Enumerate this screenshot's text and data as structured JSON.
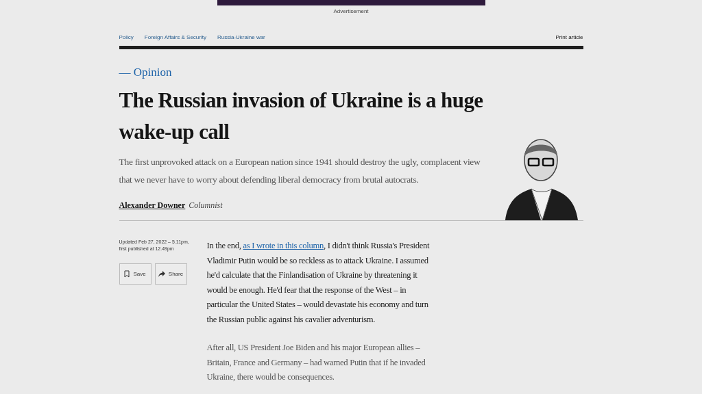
{
  "advertisement": {
    "label": "Advertisement"
  },
  "breadcrumbs": [
    "Policy",
    "Foreign Affairs & Security",
    "Russia-Ukraine war"
  ],
  "print_link": "Print article",
  "section": "— Opinion",
  "headline": "The Russian invasion of Ukraine is a huge wake-up call",
  "standfirst": "The first unprovoked attack on a European nation since 1941 should destroy the ugly, complacent view that we never have to worry about defending liberal democracy from brutal autocrats.",
  "byline": {
    "author": "Alexander Downer",
    "role": "Columnist"
  },
  "meta": {
    "updated": "Updated Feb 27, 2022 – 5.11pm,",
    "published": "first published at 12.49pm"
  },
  "actions": [
    {
      "kind": "save",
      "label": "Save"
    },
    {
      "kind": "share",
      "label": "Share"
    }
  ],
  "body": [
    {
      "before": "In the end, ",
      "link": "as I wrote in this column",
      "after": ", I didn't think Russia's President Vladimir Putin would be so reckless as to attack Ukraine. I assumed he'd calculate that the Finlandisation of Ukraine by threatening it would be enough. He'd fear that the response of the West – in particular the United States – would devastate his economy and turn the Russian public against his cavalier adventurism."
    },
    {
      "before": "After all, US President Joe Biden and his major European allies – Britain, France and Germany – had warned Putin that if he invaded Ukraine, there would be consequences."
    }
  ]
}
